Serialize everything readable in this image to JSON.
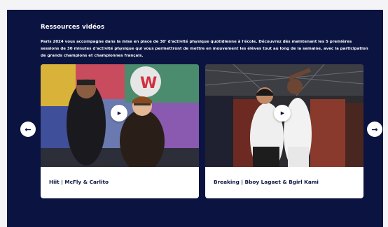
{
  "section": {
    "title": "Ressources vidéos",
    "description": "Paris 2024 vous accompagne dans la mise en place de 30' d'activité physique quotidienne à l'école. Découvrez dès maintenant les 5 premières sessions de 30 minutes d'activité physique qui vous permettront de mettre en mouvement les élèves tout au long de la semaine, avec la participation de grands champions et championnes français."
  },
  "carousel": {
    "prev_icon": "←",
    "next_icon": "→",
    "play_icon": "▶",
    "cards": [
      {
        "label": "Hiit | McFly & Carlito"
      },
      {
        "label": "Breaking | Bboy Lagaet & Bgirl Kami"
      }
    ]
  },
  "colors": {
    "background": "#0b1440",
    "card": "#ffffff"
  }
}
